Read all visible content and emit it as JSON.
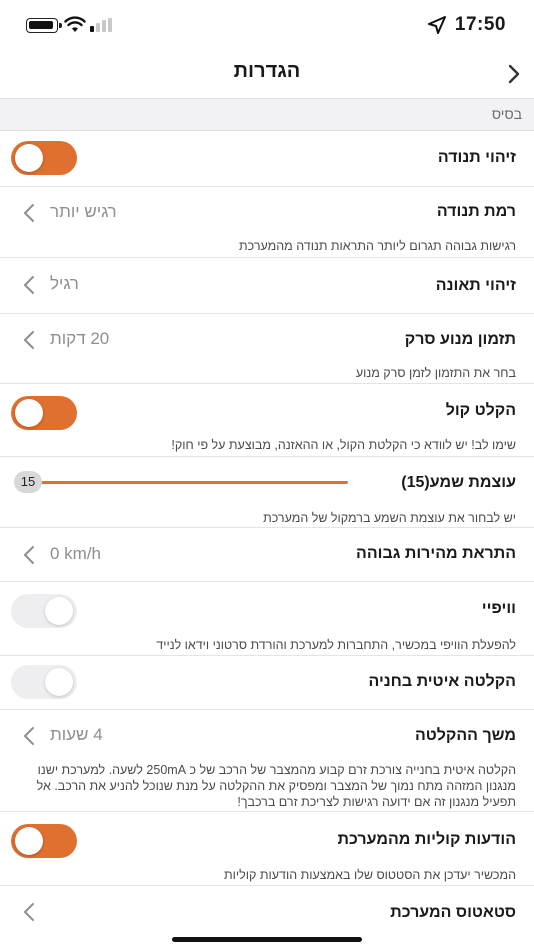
{
  "status_bar": {
    "time": "17:50"
  },
  "header": {
    "title": "הגדרות"
  },
  "section": {
    "title": "בסיס"
  },
  "rows": {
    "motion_detection": {
      "label": "זיהוי תנודה",
      "toggle_on": true
    },
    "motion_level": {
      "label": "רמת תנודה",
      "value": "רגיש יותר",
      "desc": "רגישות גבוהה תגרום ליותר התראות תנודה מהמערכת"
    },
    "accident_detection": {
      "label": "זיהוי תאונה",
      "value": "רגיל"
    },
    "scan_timer": {
      "label": "תזמון מנוע סרק",
      "value": "20 דקות",
      "desc": "בחר את התזמון לזמן סרק מנוע"
    },
    "voice_recording": {
      "label": "הקלט קול",
      "toggle_on": true,
      "desc": "שימו לב! יש לוודא כי הקלטת הקול, או ההאזנה, מבוצעת על פי חוק!"
    },
    "volume": {
      "label": "עוצמת שמע(15)",
      "slider_value": "15",
      "slider_max": 15,
      "desc": "יש לבחור את עוצמת השמע ברמקול של המערכת"
    },
    "speed_alert": {
      "label": "התראת מהירות גבוהה",
      "value": "0 km/h"
    },
    "wifi": {
      "label": "ווי‏פיי",
      "toggle_on": false,
      "desc": "להפעלת הוויפי במכשיר, התחברות למערכת והורדת סרטוני וידאו לנייד"
    },
    "parking_recording": {
      "label": "הקלטה איטית בחניה",
      "toggle_on": false
    },
    "recording_duration": {
      "label": "משך ההקלטה",
      "value": "4 שעות",
      "desc": "הקלטה איטית בחנייה צורכת זרם קבוע מהמצבר של הרכב של כ 250mA לשעה. למערכת ישנו מנגנון המזהה מתח נמוך של המצבר ומפסיק את ההקלטה על מנת שנוכל להניע את הרכב. אל תפעיל מנגנון זה אם ידועה רגישות לצריכת זרם ברכבך!"
    },
    "voice_messages": {
      "label": "הודעות קוליות מהמערכת",
      "toggle_on": true,
      "desc": "המכשיר יעדכן את הסטטוס שלו באמצעות הודעות קוליות"
    },
    "system_status": {
      "label": "סטאטוס המערכת"
    }
  },
  "colors": {
    "accent": "#e07030",
    "toggle_off": "#e9e9eb",
    "section_bg": "#f2f2f4"
  }
}
